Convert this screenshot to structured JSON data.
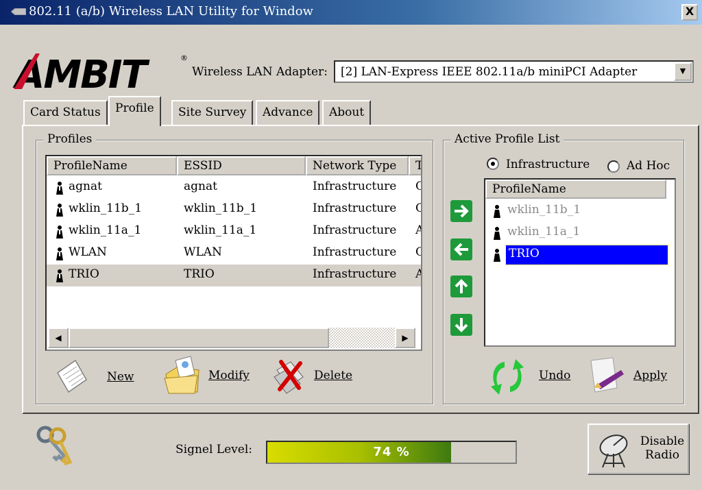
{
  "window": {
    "title": "802.11 (a/b) Wireless LAN Utility for Window",
    "close_label": "X"
  },
  "brand": {
    "logo_text": "AMBIT",
    "registered": "®"
  },
  "adapter": {
    "label": "Wireless LAN Adapter:",
    "selected": "[2] LAN-Express IEEE 802.11a/b miniPCI Adapter"
  },
  "tabs": [
    {
      "label": "Card Status"
    },
    {
      "label": "Profile",
      "active": true
    },
    {
      "label": "Site Survey"
    },
    {
      "label": "Advance"
    },
    {
      "label": "About"
    }
  ],
  "profiles": {
    "legend": "Profiles",
    "columns": [
      "ProfileName",
      "ESSID",
      "Network Type",
      "T"
    ],
    "rows": [
      {
        "name": "agnat",
        "essid": "agnat",
        "type": "Infrastructure",
        "extra": "C"
      },
      {
        "name": "wklin_11b_1",
        "essid": "wklin_11b_1",
        "type": "Infrastructure",
        "extra": "C"
      },
      {
        "name": "wklin_11a_1",
        "essid": "wklin_11a_1",
        "type": "Infrastructure",
        "extra": "A"
      },
      {
        "name": "WLAN",
        "essid": "WLAN",
        "type": "Infrastructure",
        "extra": "C"
      },
      {
        "name": "TRIO",
        "essid": "TRIO",
        "type": "Infrastructure",
        "extra": "A",
        "selected": true
      }
    ],
    "actions": {
      "new": "New",
      "modify": "Modify",
      "delete": "Delete"
    }
  },
  "active_list": {
    "legend": "Active Profile List",
    "mode_infrastructure": "Infrastructure",
    "mode_adhoc": "Ad Hoc",
    "mode_selected": "Infrastructure",
    "column": "ProfileName",
    "items": [
      {
        "name": "wklin_11b_1",
        "dimmed": true
      },
      {
        "name": "wklin_11a_1",
        "dimmed": true
      },
      {
        "name": "TRIO",
        "selected": true
      }
    ],
    "actions": {
      "undo": "Undo",
      "apply": "Apply"
    }
  },
  "status": {
    "signal_label": "Signel Level:",
    "signal_percent": 74,
    "signal_text": "74 %",
    "radio_button_line1": "Disable",
    "radio_button_line2": "Radio"
  },
  "colors": {
    "selection": "#0000ff",
    "window": "#d4d0c8",
    "titlebar": "#0a246a",
    "arrow_green": "#1e9a3a"
  },
  "icons": [
    "network-card-icon",
    "close-icon",
    "ambit-logo",
    "dropdown-arrow-icon",
    "person-icon",
    "new-document-icon",
    "modify-folder-icon",
    "delete-icon",
    "arrow-right-icon",
    "arrow-left-icon",
    "arrow-up-icon",
    "arrow-down-icon",
    "undo-icon",
    "apply-icon",
    "keys-icon",
    "satellite-dish-icon"
  ]
}
